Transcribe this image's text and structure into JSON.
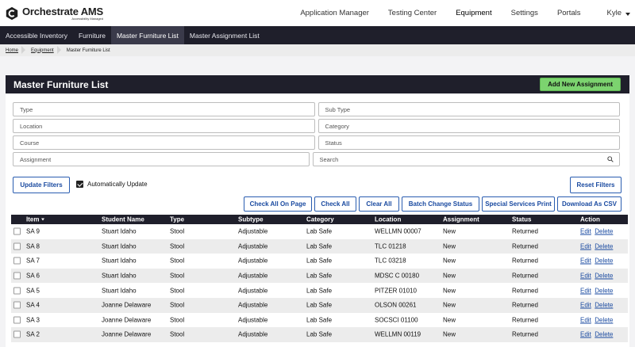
{
  "app": {
    "name": "Orchestrate AMS",
    "name_main": "Orchestrate",
    "name_suffix": " AMS",
    "tagline": "Accessibility Managed"
  },
  "topnav": {
    "items": [
      "Application Manager",
      "Testing Center",
      "Equipment",
      "Settings",
      "Portals"
    ],
    "active": "Equipment",
    "user": "Kyle"
  },
  "subnav": {
    "items": [
      "Accessible Inventory",
      "Furniture",
      "Master Furniture List",
      "Master Assignment List"
    ],
    "active": "Master Furniture List"
  },
  "breadcrumb": [
    "Home",
    "Equipment",
    "Master Furniture List"
  ],
  "panel": {
    "title": "Master Furniture List",
    "add_button": "Add New Assignment"
  },
  "filters": {
    "type": "Type",
    "subtype": "Sub Type",
    "location": "Location",
    "category": "Category",
    "course": "Course",
    "status": "Status",
    "assignment": "Assignment",
    "search": "Search"
  },
  "controls": {
    "update_filters": "Update Filters",
    "auto_update": "Automatically Update",
    "reset_filters": "Reset Filters",
    "check_all_on_page": "Check All On Page",
    "check_all": "Check All",
    "clear_all": "Clear All",
    "batch_change_status": "Batch Change Status",
    "special_services_print": "Special Services Print",
    "download_csv": "Download As CSV"
  },
  "table": {
    "columns": [
      "Item",
      "Student Name",
      "Type",
      "Subtype",
      "Category",
      "Location",
      "Assignment",
      "Status",
      "Action"
    ],
    "edit_label": "Edit",
    "delete_label": "Delete",
    "rows": [
      {
        "item": "SA 9",
        "student": "Stuart Idaho",
        "type": "Stool",
        "subtype": "Adjustable",
        "category": "Lab Safe",
        "location": "WELLMN 00007",
        "assignment": "New",
        "status": "Returned"
      },
      {
        "item": "SA 8",
        "student": "Stuart Idaho",
        "type": "Stool",
        "subtype": "Adjustable",
        "category": "Lab Safe",
        "location": "TLC 01218",
        "assignment": "New",
        "status": "Returned"
      },
      {
        "item": "SA 7",
        "student": "Stuart Idaho",
        "type": "Stool",
        "subtype": "Adjustable",
        "category": "Lab Safe",
        "location": "TLC 03218",
        "assignment": "New",
        "status": "Returned"
      },
      {
        "item": "SA 6",
        "student": "Stuart Idaho",
        "type": "Stool",
        "subtype": "Adjustable",
        "category": "Lab Safe",
        "location": "MDSC C 00180",
        "assignment": "New",
        "status": "Returned"
      },
      {
        "item": "SA 5",
        "student": "Stuart Idaho",
        "type": "Stool",
        "subtype": "Adjustable",
        "category": "Lab Safe",
        "location": "PITZER 01010",
        "assignment": "New",
        "status": "Returned"
      },
      {
        "item": "SA 4",
        "student": "Joanne Delaware",
        "type": "Stool",
        "subtype": "Adjustable",
        "category": "Lab Safe",
        "location": "OLSON 00261",
        "assignment": "New",
        "status": "Returned"
      },
      {
        "item": "SA 3",
        "student": "Joanne Delaware",
        "type": "Stool",
        "subtype": "Adjustable",
        "category": "Lab Safe",
        "location": "SOCSCI 01100",
        "assignment": "New",
        "status": "Returned"
      },
      {
        "item": "SA 2",
        "student": "Joanne Delaware",
        "type": "Stool",
        "subtype": "Adjustable",
        "category": "Lab Safe",
        "location": "WELLMN 00119",
        "assignment": "New",
        "status": "Returned"
      }
    ]
  },
  "colors": {
    "dark": "#1f1f2b",
    "accent_green": "#7cd36f",
    "link_blue": "#1a4aa0"
  }
}
